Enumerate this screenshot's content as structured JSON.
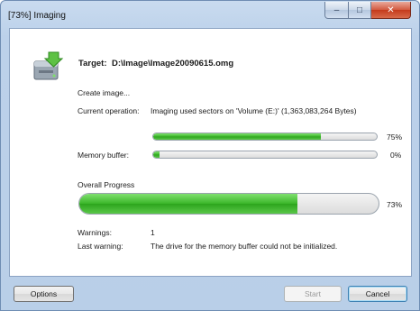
{
  "window": {
    "title": "[73%] Imaging",
    "minimize_glyph": "–",
    "maximize_glyph": "□",
    "close_glyph": "✕"
  },
  "header": {
    "target_label": "Target:",
    "target_value": "D:\\Image\\Image20090615.omg"
  },
  "status": {
    "create_image": "Create image...",
    "current_operation_label": "Current operation:",
    "current_operation_value": "Imaging used sectors on 'Volume (E:)' (1,363,083,264 Bytes)"
  },
  "progress": {
    "operation": {
      "percent_text": "75%",
      "value": 0.75
    },
    "memory_buffer": {
      "label": "Memory buffer:",
      "percent_text": "0%",
      "value": 0.0
    },
    "overall": {
      "label": "Overall Progress",
      "percent_text": "73%",
      "value": 0.73
    }
  },
  "warnings": {
    "count_label": "Warnings:",
    "count_value": "1",
    "last_label": "Last warning:",
    "last_value": "The drive for the memory buffer could not be initialized."
  },
  "buttons": {
    "options": "Options",
    "start": "Start",
    "cancel": "Cancel"
  },
  "icons": {
    "app": "drive-imaging-icon"
  },
  "colors": {
    "progress_fill": "#3bb629",
    "close_button": "#c43a1b"
  }
}
